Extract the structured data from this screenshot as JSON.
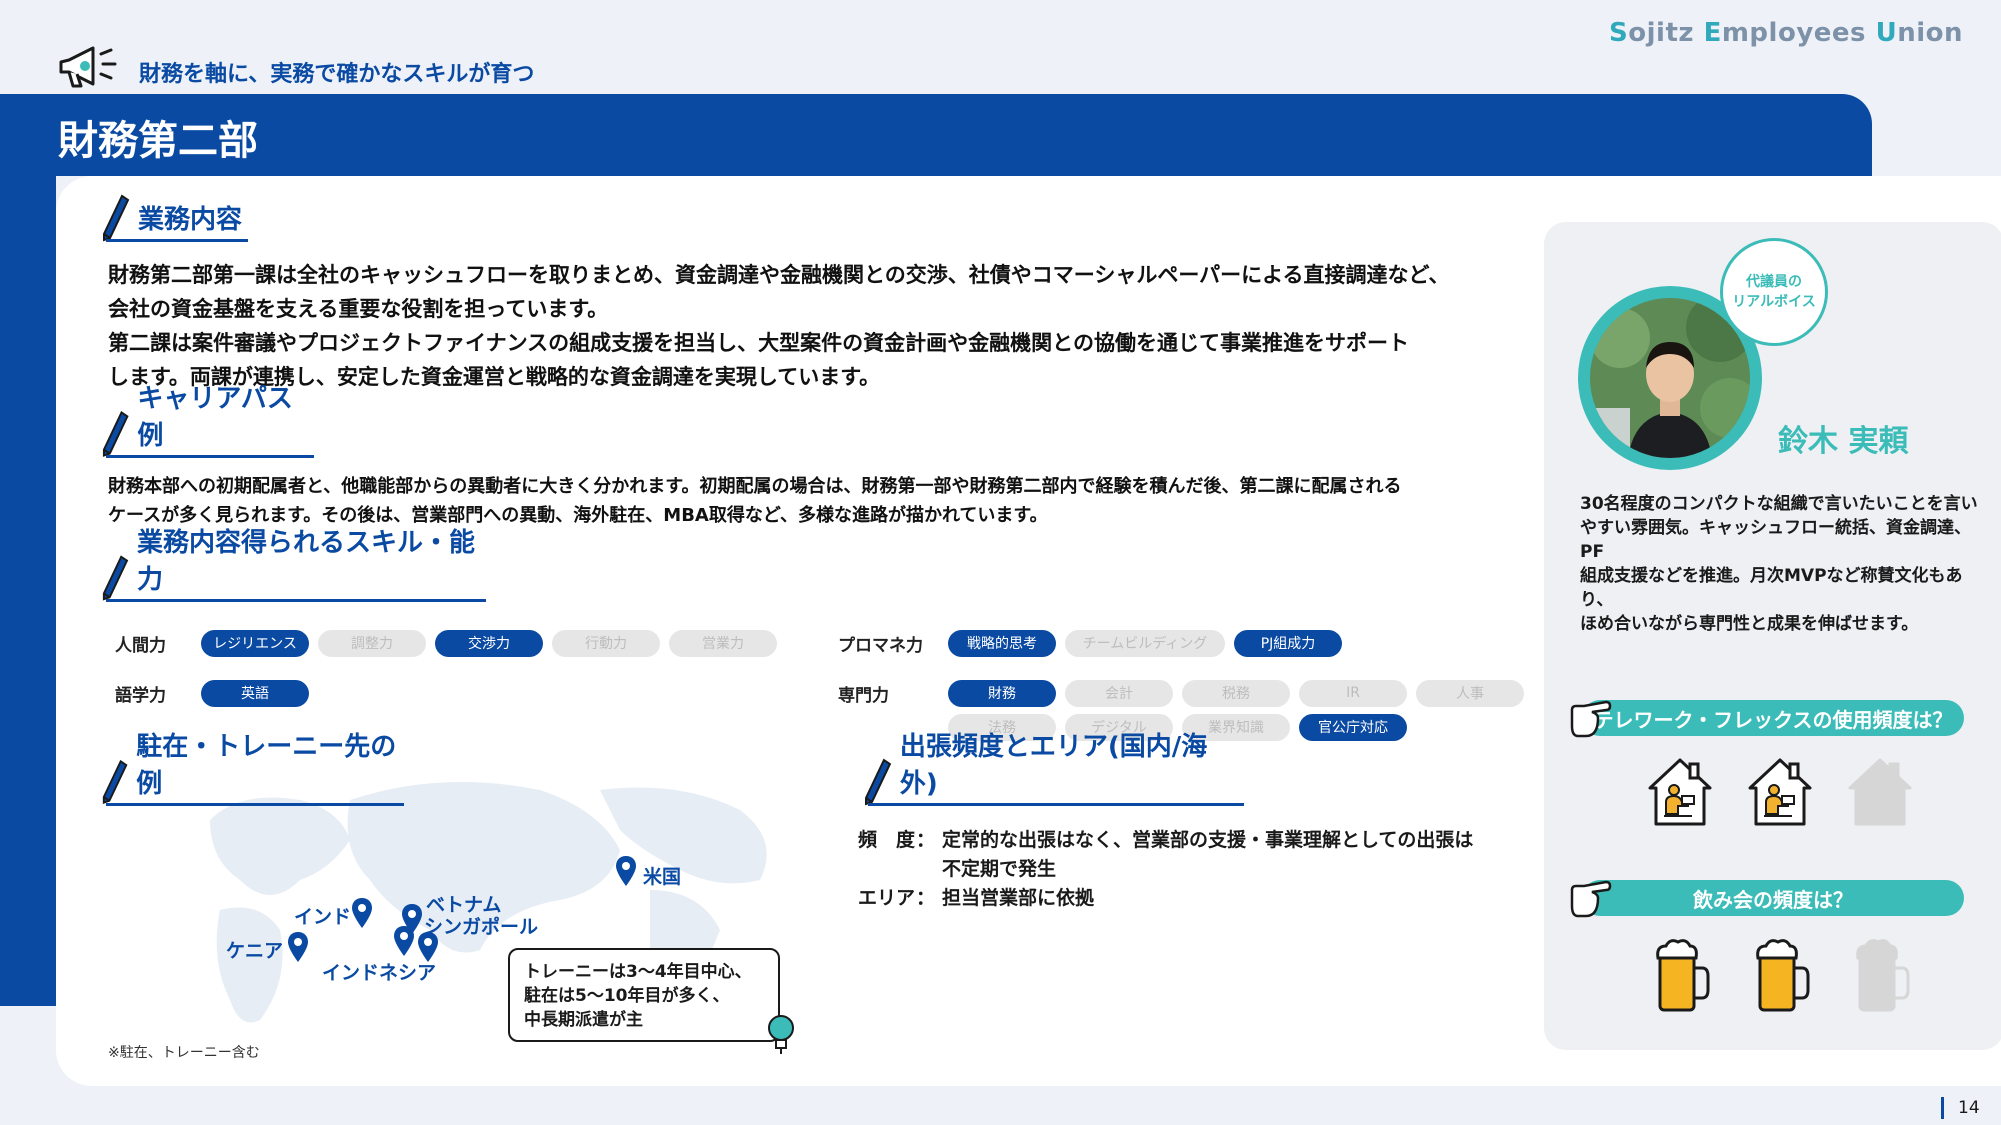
{
  "header": {
    "tagline": "財務を軸に、実務で確かなスキルが育つ",
    "brand_parts": [
      "S",
      "ojitz ",
      "E",
      "mployees ",
      "U",
      "nion"
    ],
    "page_title": "財務第二部"
  },
  "sections": {
    "business": {
      "heading": "業務内容",
      "lines": [
        "財務第二部第一課は全社のキャッシュフローを取りまとめ、資金調達や金融機関との交渉、社債やコマーシャルペーパーによる直接調達など、",
        "会社の資金基盤を支える重要な役割を担っています。",
        "第二課は案件審議やプロジェクトファイナンスの組成支援を担当し、大型案件の資金計画や金融機関との協働を通じて事業推進をサポート",
        "します。両課が連携し、安定した資金運営と戦略的な資金調達を実現しています。"
      ]
    },
    "career": {
      "heading": "キャリアパス例",
      "lines": [
        "財務本部への初期配属者と、他職能部からの異動者に大きく分かれます。初期配属の場合は、財務第一部や財務第二部内で経験を積んだ後、第二課に配属される",
        "ケースが多く見られます。その後は、営業部門への異動、海外駐在、MBA取得など、多様な進路が描かれています。"
      ]
    },
    "skills": {
      "heading": "業務内容得られるスキル・能力",
      "rows": [
        {
          "category": "人間力",
          "pills": [
            {
              "label": "レジリエンス",
              "on": true
            },
            {
              "label": "調整力",
              "on": false
            },
            {
              "label": "交渉力",
              "on": true
            },
            {
              "label": "行動力",
              "on": false
            },
            {
              "label": "営業力",
              "on": false
            }
          ]
        },
        {
          "category": "語学力",
          "pills": [
            {
              "label": "英語",
              "on": true
            }
          ]
        },
        {
          "category": "プロマネ力",
          "pills": [
            {
              "label": "戦略的思考",
              "on": true
            },
            {
              "label": "チームビルディング",
              "on": false
            },
            {
              "label": "PJ組成力",
              "on": true
            }
          ]
        },
        {
          "category": "専門力",
          "pills": [
            {
              "label": "財務",
              "on": true
            },
            {
              "label": "会計",
              "on": false
            },
            {
              "label": "税務",
              "on": false
            },
            {
              "label": "IR",
              "on": false
            },
            {
              "label": "人事",
              "on": false
            },
            {
              "label": "法務",
              "on": false
            },
            {
              "label": "デジタル",
              "on": false
            },
            {
              "label": "業界知識",
              "on": false
            },
            {
              "label": "官公庁対応",
              "on": true
            }
          ]
        }
      ]
    },
    "overseas": {
      "heading": "駐在・トレーニー先の例",
      "locations": [
        "米国",
        "インド",
        "ベトナム",
        "シンガポール",
        "ケニア",
        "インドネシア"
      ],
      "note_lines": [
        "トレーニーは3～4年目中心、",
        "駐在は5～10年目が多く、",
        "中長期派遣が主"
      ],
      "footnote": "※駐在、トレーニー含む"
    },
    "travel": {
      "heading": "出張頻度とエリア(国内/海外)",
      "freq_label": "頻　度",
      "area_label": "エリア",
      "colon": "：",
      "freq_lines": [
        "定常的な出張はなく、営業部の支援・事業理解としての出張は",
        "不定期で発生"
      ],
      "area_value": "担当営業部に依拠"
    }
  },
  "voice": {
    "bubble": [
      "代議員の",
      "リアルボイス"
    ],
    "name": "鈴木 実頼",
    "comment_lines": [
      "30名程度のコンパクトな組織で言いたいことを言い",
      "やすい雰囲気。キャッシュフロー統括、資金調達、PF",
      "組成支援などを推進。月次MVPなど称賛文化もあり、",
      "ほめ合いながら専門性と成果を伸ばせます。"
    ],
    "q1": "テレワーク・フレックスの使用頻度は？",
    "q1_level": 2,
    "q1_max": 3,
    "q2": "飲み会の頻度は？",
    "q2_level": 2,
    "q2_max": 3
  },
  "colors": {
    "primary": "#0a4aa3",
    "teal": "#3bbcb8",
    "pill_off": "#e6e6e6"
  },
  "footer": {
    "page_number": "14"
  }
}
